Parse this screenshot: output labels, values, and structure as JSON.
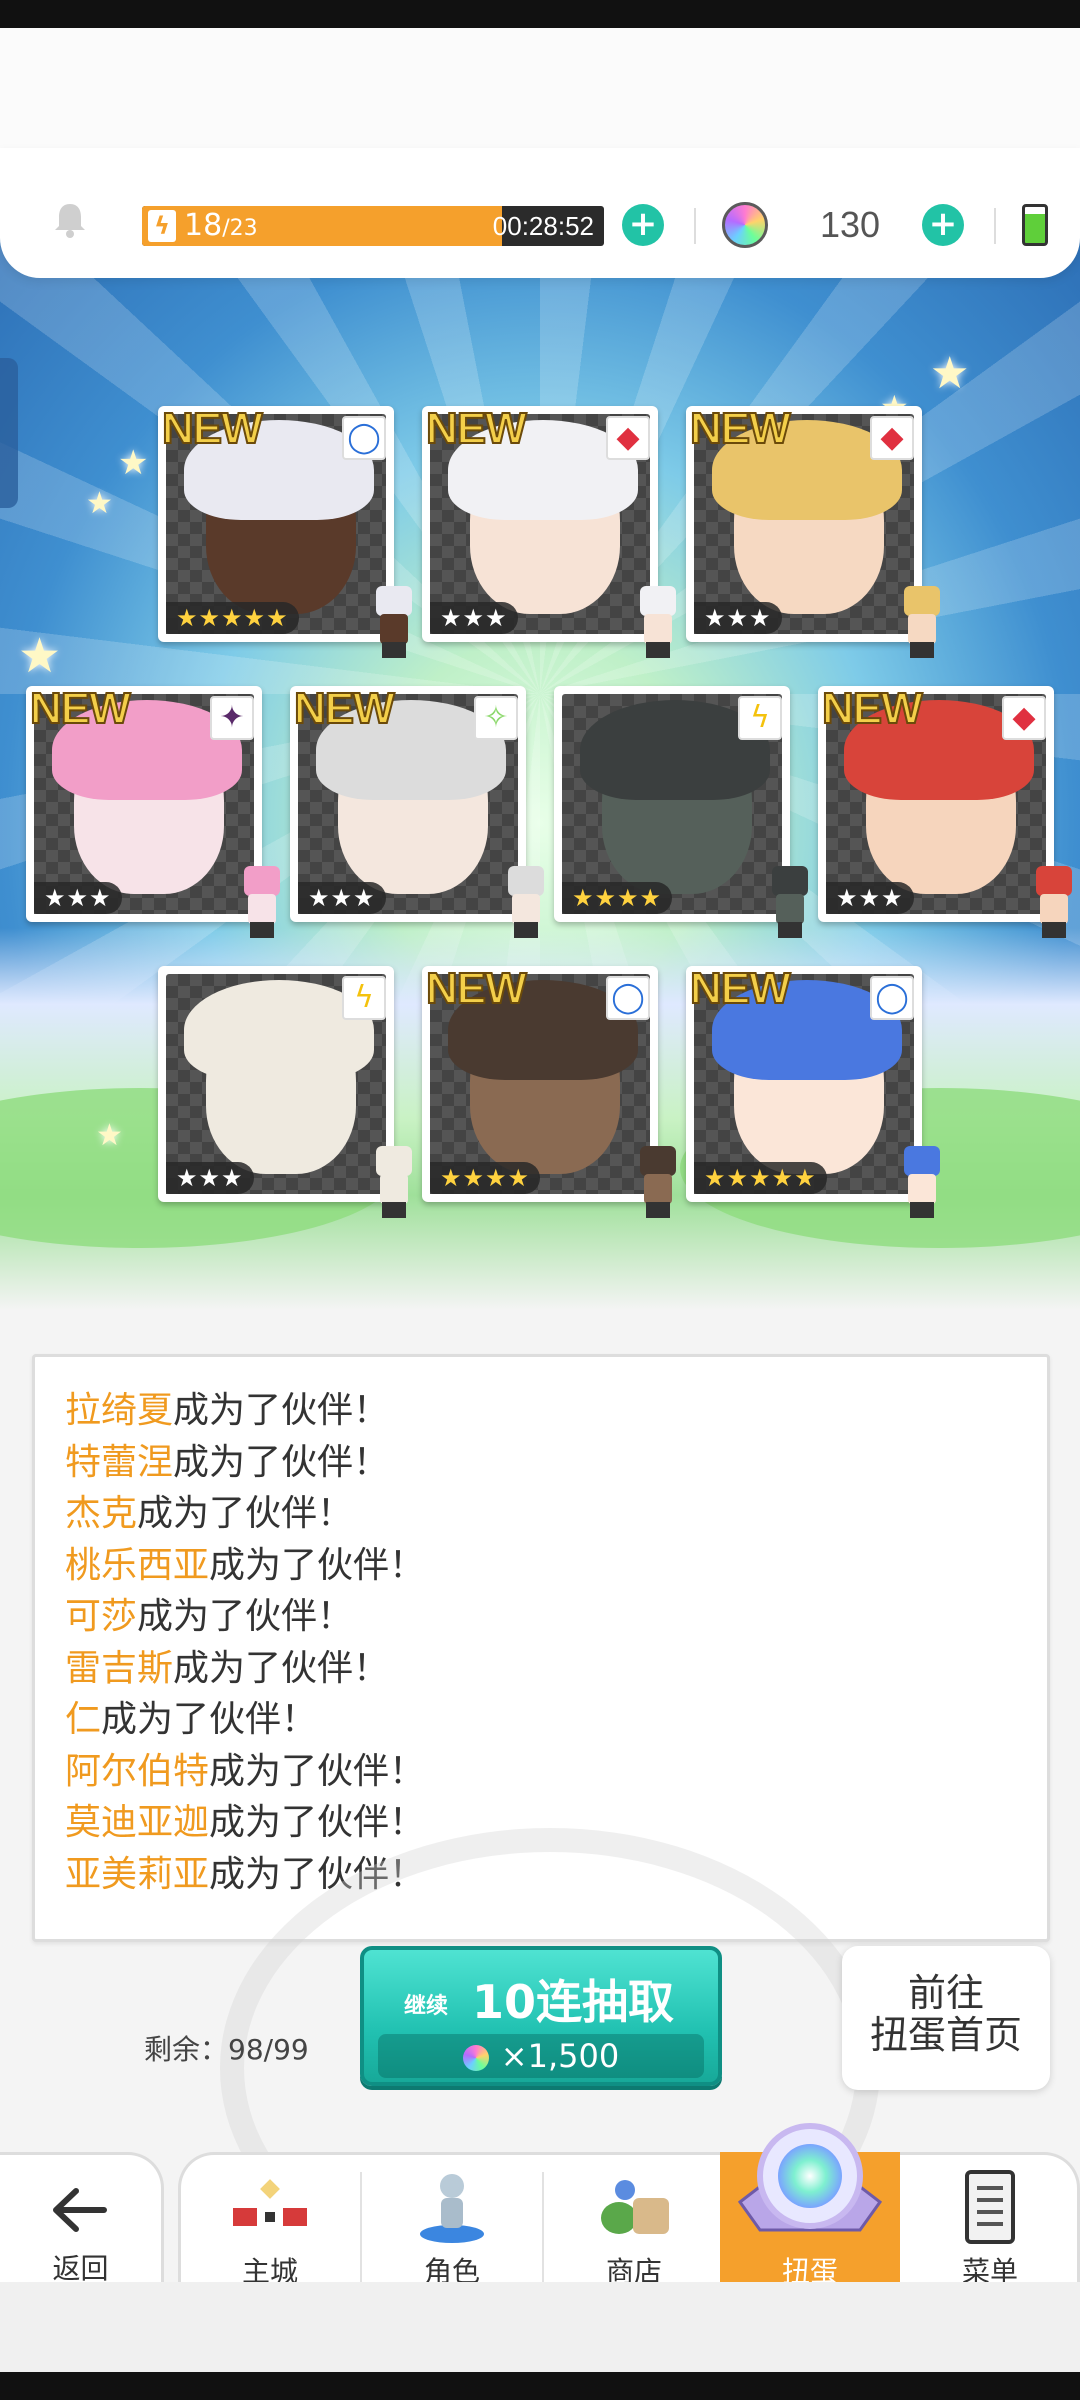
{
  "header": {
    "stamina_current": "18",
    "stamina_max": "/23",
    "stamina_fraction": 0.78,
    "timer": "00:28:52",
    "gem_count": "130"
  },
  "cards": [
    {
      "new": "NEW",
      "element": "circle-blue-icon",
      "stars": "★★★★★",
      "rarity": 5,
      "hair": "#e9e9f1",
      "skin": "#5a3a2a"
    },
    {
      "new": "NEW",
      "element": "diamond-red-icon",
      "stars": "★★★",
      "rarity": 3,
      "hair": "#f1f1f4",
      "skin": "#f7e3d6"
    },
    {
      "new": "NEW",
      "element": "diamond-red-icon",
      "stars": "★★★",
      "rarity": 3,
      "hair": "#e9c46a",
      "skin": "#f6d9c2"
    },
    {
      "new": "NEW",
      "element": "star-purple-icon",
      "stars": "★★★",
      "rarity": 3,
      "hair": "#f29ec8",
      "skin": "#f7e3e8"
    },
    {
      "new": "NEW",
      "element": "sparkle-green-icon",
      "stars": "★★★",
      "rarity": 3,
      "hair": "#dcdcdc",
      "skin": "#f4e7de"
    },
    {
      "new": "",
      "element": "bolt-yellow-icon",
      "stars": "★★★★",
      "rarity": 4,
      "hair": "#3b3f3f",
      "skin": "#55605a"
    },
    {
      "new": "NEW",
      "element": "diamond-red-icon",
      "stars": "★★★",
      "rarity": 3,
      "hair": "#d8443a",
      "skin": "#f6d5bd"
    },
    {
      "new": "",
      "element": "bolt-yellow-icon",
      "stars": "★★★",
      "rarity": 3,
      "hair": "#efeae0",
      "skin": "#efeae0"
    },
    {
      "new": "NEW",
      "element": "circle-blue-icon",
      "stars": "★★★★",
      "rarity": 4,
      "hair": "#4a3a30",
      "skin": "#8a6a52"
    },
    {
      "new": "NEW",
      "element": "circle-blue-icon",
      "stars": "★★★★★",
      "rarity": 5,
      "hair": "#4a78e0",
      "skin": "#fbe6d8"
    }
  ],
  "messages": [
    {
      "name": "拉绮夏",
      "text": "成为了伙伴！"
    },
    {
      "name": "特蕾涅",
      "text": "成为了伙伴！"
    },
    {
      "name": "杰克",
      "text": "成为了伙伴！"
    },
    {
      "name": "桃乐西亚",
      "text": "成为了伙伴！"
    },
    {
      "name": "可莎",
      "text": "成为了伙伴！"
    },
    {
      "name": "雷吉斯",
      "text": "成为了伙伴！"
    },
    {
      "name": "仁",
      "text": "成为了伙伴！"
    },
    {
      "name": "阿尔伯特",
      "text": "成为了伙伴！"
    },
    {
      "name": "莫迪亚迦",
      "text": "成为了伙伴！"
    },
    {
      "name": "亚美莉亚",
      "text": "成为了伙伴！"
    }
  ],
  "actions": {
    "remaining": "剩余：98/99",
    "continue_label": "继续",
    "pull_label": "10连抽取",
    "pull_cost": "×1,500",
    "goto_line1": "前往",
    "goto_line2": "扭蛋首页"
  },
  "nav": {
    "back": "返回",
    "items": [
      "主城",
      "角色",
      "商店",
      "扭蛋",
      "菜单"
    ],
    "active_index": 3
  },
  "colors": {
    "accent_orange": "#f5a02c",
    "teal": "#22c3a6",
    "name_highlight": "#f09a1f"
  }
}
